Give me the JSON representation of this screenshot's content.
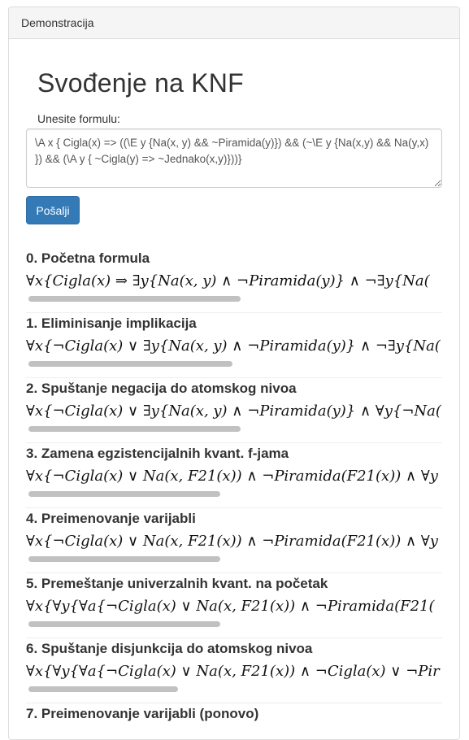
{
  "panel": {
    "heading": "Demonstracija"
  },
  "main": {
    "title": "Svođenje na KNF",
    "prompt": "Unesite formulu:",
    "formula_value": "\\A x { Cigla(x) => ((\\E y {Na(x, y) && ~Piramida(y)}) && (~\\E y {Na(x,y) && Na(y,x) }) && (\\A y { ~Cigla(y) => ~Jednako(x,y)}))}",
    "submit_label": "Pošalji"
  },
  "steps": [
    {
      "title": "0. Početna formula",
      "expr": "∀x{Cigla(x) ⇒ ∃y{Na(x, y) ∧ ¬Piramida(y)} ∧ ¬∃y{Na(",
      "scroll_fraction": 0.51
    },
    {
      "title": "1. Eliminisanje implikacija",
      "expr": "∀x{¬Cigla(x) ∨ ∃y{Na(x, y) ∧ ¬Piramida(y)} ∧ ¬∃y{Na(",
      "scroll_fraction": 0.49
    },
    {
      "title": "2. Spuštanje negacija do atomskog nivoa",
      "expr": "∀x{¬Cigla(x) ∨ ∃y{Na(x, y) ∧ ¬Piramida(y)} ∧ ∀y{¬Na(",
      "scroll_fraction": 0.51
    },
    {
      "title": "3. Zamena egzistencijalnih kvant. f-jama",
      "expr": "∀x{¬Cigla(x) ∨ Na(x, F21(x)) ∧ ¬Piramida(F21(x)) ∧ ∀y",
      "scroll_fraction": 0.46
    },
    {
      "title": "4. Preimenovanje varijabli",
      "expr": "∀x{¬Cigla(x) ∨ Na(x, F21(x)) ∧ ¬Piramida(F21(x)) ∧ ∀y",
      "scroll_fraction": 0.46
    },
    {
      "title": "5. Premeštanje univerzalnih kvant. na početak",
      "expr": "∀x{∀y{∀a{¬Cigla(x) ∨ Na(x, F21(x)) ∧ ¬Piramida(F21(",
      "scroll_fraction": 0.46
    },
    {
      "title": "6. Spuštanje disjunkcija do atomskog nivoa",
      "expr": "∀x{∀y{∀a{¬Cigla(x) ∨ Na(x, F21(x)) ∧ ¬Cigla(x) ∨ ¬Pir",
      "scroll_fraction": 0.36
    },
    {
      "title": "7. Preimenovanje varijabli (ponovo)",
      "expr": "",
      "scroll_fraction": 0.36
    }
  ]
}
